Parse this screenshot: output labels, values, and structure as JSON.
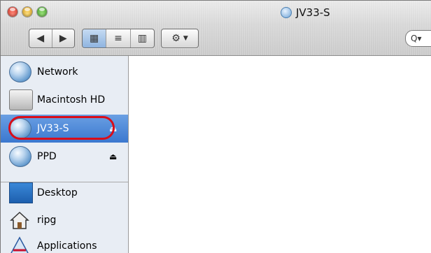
{
  "window": {
    "title": "JV33-S"
  },
  "toolbar": {
    "back_icon": "back-arrow",
    "forward_icon": "forward-arrow",
    "view_icon_label": "icon view",
    "view_list_label": "list view",
    "view_column_label": "column view",
    "action_label": "action",
    "search_prefix": "Q▾"
  },
  "sidebar": {
    "items": [
      {
        "label": "Network",
        "icon": "globe-icon"
      },
      {
        "label": "Macintosh HD",
        "icon": "hard-drive-icon"
      },
      {
        "label": "JV33-S",
        "icon": "globe-icon",
        "eject": "⏏",
        "selected": true
      },
      {
        "label": "PPD",
        "icon": "globe-icon",
        "eject": "⏏"
      },
      {
        "label": "Desktop",
        "icon": "desktop-icon"
      },
      {
        "label": "ripg",
        "icon": "home-icon"
      },
      {
        "label": "Applications",
        "icon": "applications-icon"
      }
    ]
  },
  "colors": {
    "selection": "#3b78cf",
    "highlight_ring": "#d90d1a"
  }
}
